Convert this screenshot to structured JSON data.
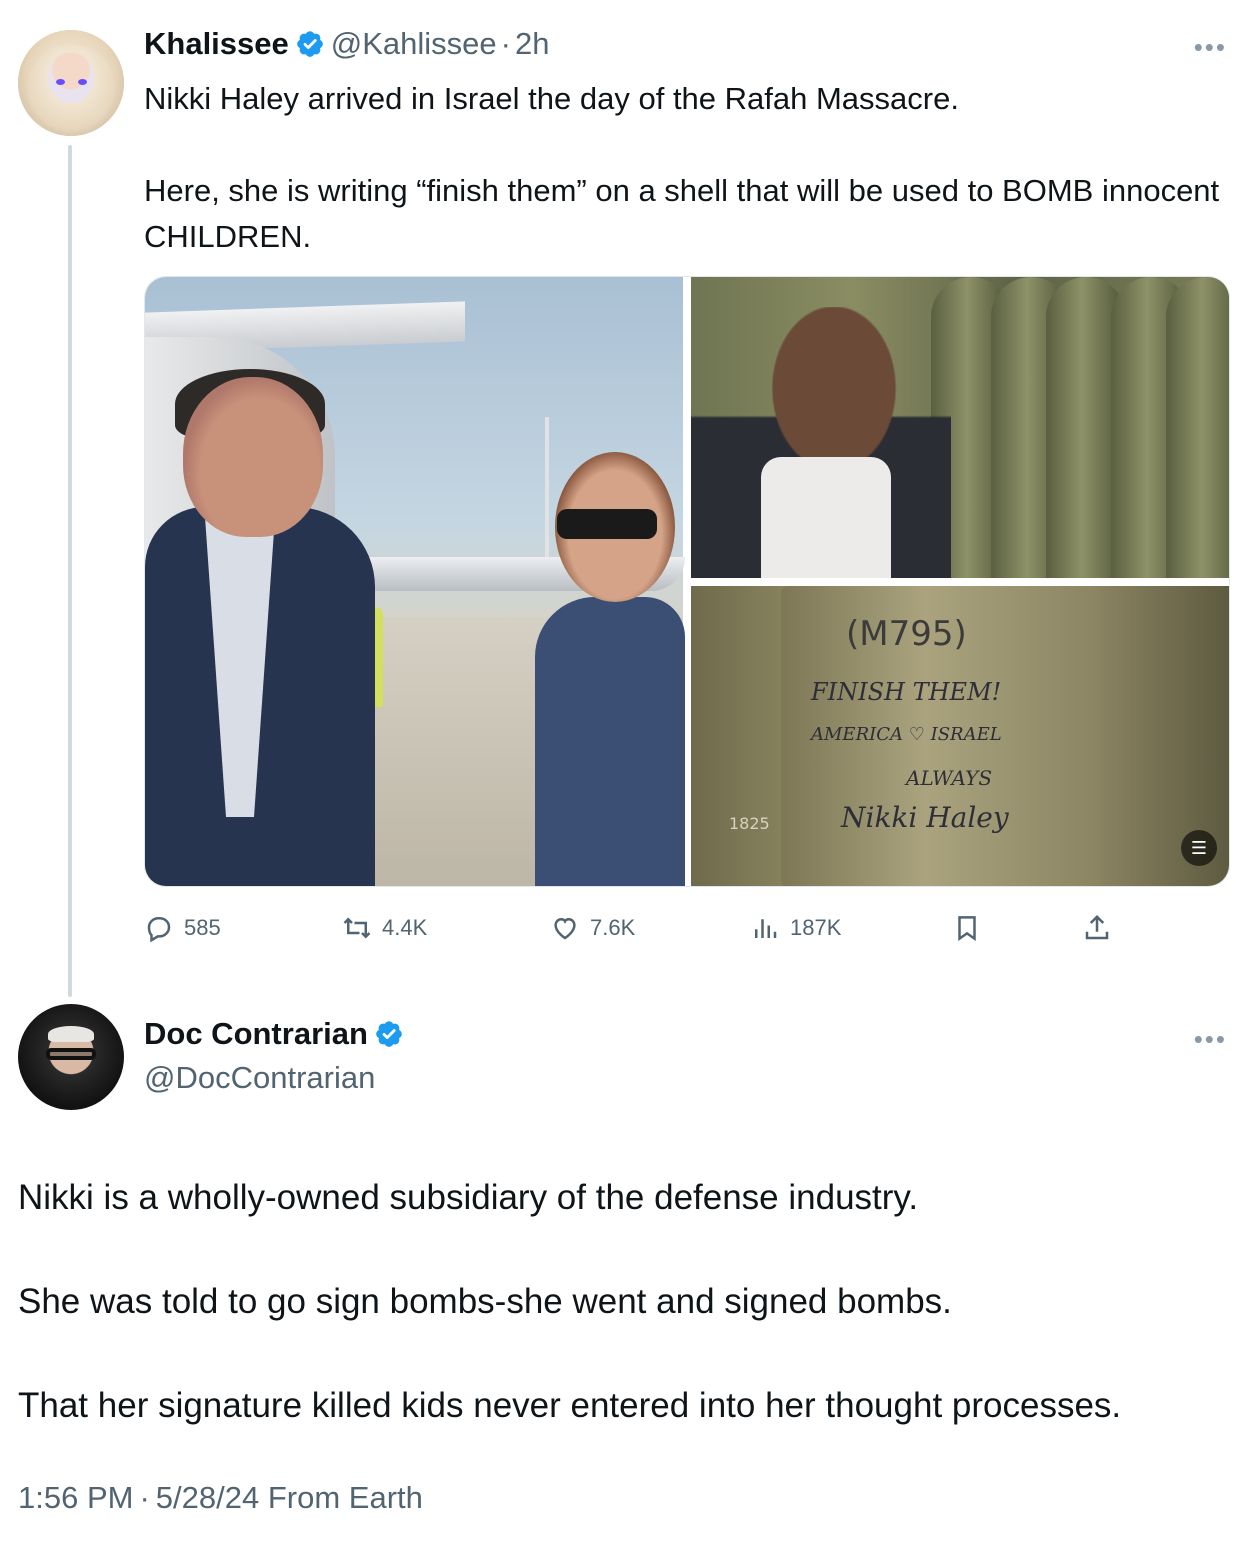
{
  "colors": {
    "text": "#0f1419",
    "secondary": "#536471",
    "verified": "#1d9bf0",
    "thread_line": "#cfd9de"
  },
  "quoted_tweet": {
    "author_name": "Khalissee",
    "handle": "@Kahlissee",
    "separator": "·",
    "age": "2h",
    "more_icon": "more-dots-icon",
    "text": "Nikki Haley arrived in Israel the day of the Rafah Massacre.\n\nHere, she is writing “finish them” on a shell that will be used to BOMB innocent CHILDREN.",
    "media": {
      "shell_markings": [
        "(M795)",
        "FINISH THEM!",
        "AMERICA ♡ ISRAEL",
        "ALWAYS",
        "Nikki Haley",
        "1825"
      ],
      "alt_icon": "text-recognition-icon"
    },
    "actions": {
      "replies": "585",
      "reposts": "4.4K",
      "likes": "7.6K",
      "views": "187K",
      "icons": [
        "reply-icon",
        "repost-icon",
        "like-icon",
        "views-icon",
        "bookmark-icon",
        "share-icon"
      ]
    }
  },
  "main_tweet": {
    "author_name": "Doc Contrarian",
    "handle": "@DocContrarian",
    "more_icon": "more-dots-icon",
    "text": "Nikki is a wholly-owned subsidiary of the defense industry.\n\nShe was told to go sign bombs-she went and signed bombs.\n\nThat her signature killed kids never entered into her thought processes.",
    "time": "1:56 PM",
    "separator": "·",
    "date": "5/28/24",
    "source": "From Earth"
  }
}
